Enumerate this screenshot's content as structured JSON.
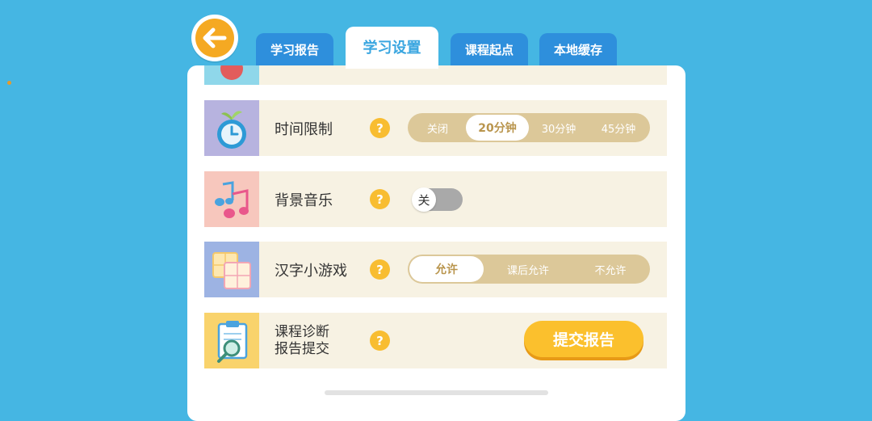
{
  "tabs": [
    {
      "label": "学习报告",
      "active": false
    },
    {
      "label": "学习设置",
      "active": true
    },
    {
      "label": "课程起点",
      "active": false
    },
    {
      "label": "本地缓存",
      "active": false
    }
  ],
  "help_symbol": "?",
  "rows": {
    "time_limit": {
      "label": "时间限制",
      "icon": "clock-icon",
      "options": [
        "关闭",
        "20分钟",
        "30分钟",
        "45分钟"
      ],
      "selected": "20分钟"
    },
    "bg_music": {
      "label": "背景音乐",
      "icon": "music-notes-icon",
      "toggle_label": "关",
      "toggle_on": false
    },
    "hanzi_game": {
      "label": "汉字小游戏",
      "icon": "character-cards-icon",
      "options": [
        "允许",
        "课后允许",
        "不允许"
      ],
      "selected": "允许"
    },
    "diagnosis": {
      "label_line1": "课程诊断",
      "label_line2": "报告提交",
      "icon": "clipboard-search-icon",
      "button_label": "提交报告"
    }
  },
  "colors": {
    "background": "#45b6e3",
    "tab": "#2e8fdc",
    "accent": "#f5a922",
    "segment": "#dcc899",
    "row": "#f7f2e3"
  }
}
